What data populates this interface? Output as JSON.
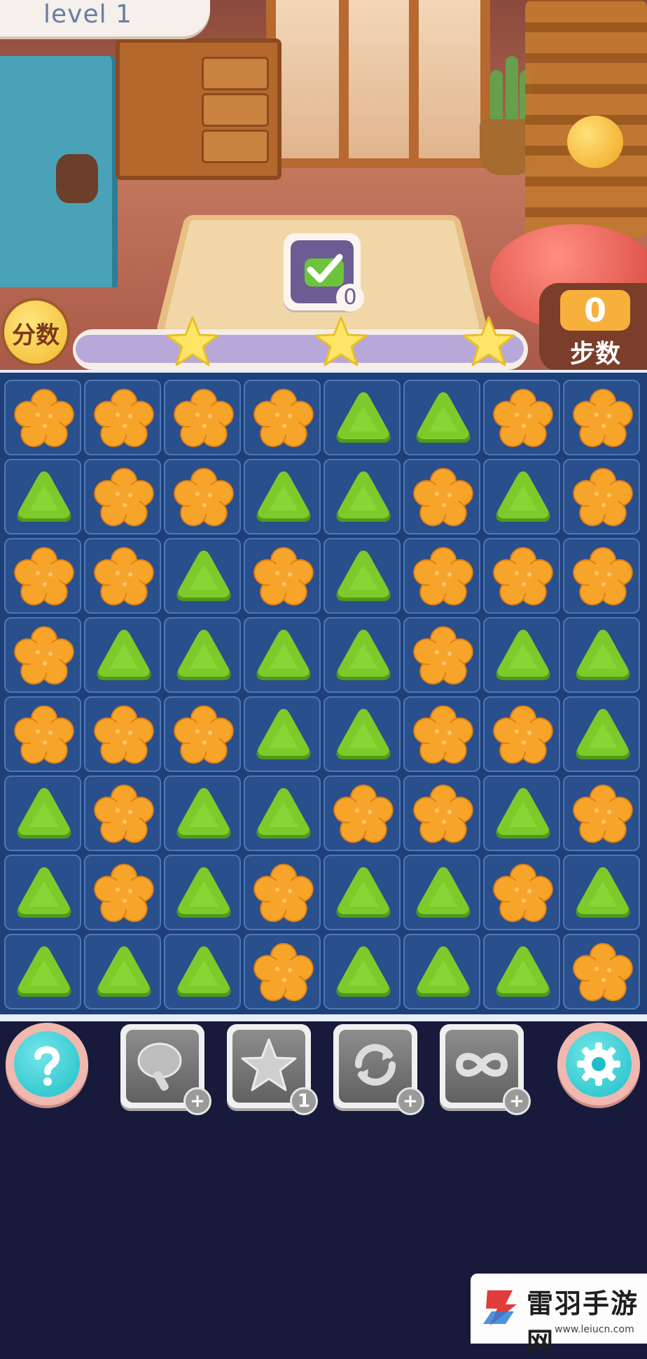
{
  "hud": {
    "level_label": "level 1",
    "goal_count": "0",
    "score_label": "分数",
    "moves_value": "0",
    "moves_label": "步数",
    "progress": 0.0,
    "stars_total": 3
  },
  "board": {
    "rows": 8,
    "cols": 8,
    "tiles": [
      [
        "flower",
        "flower",
        "flower",
        "flower",
        "triangle",
        "triangle",
        "flower",
        "flower"
      ],
      [
        "triangle",
        "flower",
        "flower",
        "triangle",
        "triangle",
        "flower",
        "triangle",
        "flower"
      ],
      [
        "flower",
        "flower",
        "triangle",
        "flower",
        "triangle",
        "flower",
        "flower",
        "flower"
      ],
      [
        "flower",
        "triangle",
        "triangle",
        "triangle",
        "triangle",
        "flower",
        "triangle",
        "triangle"
      ],
      [
        "flower",
        "flower",
        "flower",
        "triangle",
        "triangle",
        "flower",
        "flower",
        "triangle"
      ],
      [
        "triangle",
        "flower",
        "triangle",
        "triangle",
        "flower",
        "flower",
        "triangle",
        "flower"
      ],
      [
        "triangle",
        "flower",
        "triangle",
        "flower",
        "triangle",
        "triangle",
        "flower",
        "triangle"
      ],
      [
        "triangle",
        "triangle",
        "triangle",
        "flower",
        "triangle",
        "triangle",
        "triangle",
        "flower"
      ]
    ],
    "colors": {
      "flower": "#f7a52a",
      "triangle": "#7ccb2a",
      "cell": "#294f8c",
      "board": "#1f3f78"
    }
  },
  "toolbar": {
    "help_icon": "question-icon",
    "settings_icon": "gear-icon",
    "boosters": [
      {
        "icon": "hammer-icon",
        "count": "+"
      },
      {
        "icon": "star-icon",
        "count": "1"
      },
      {
        "icon": "shuffle-icon",
        "count": "+"
      },
      {
        "icon": "infinity-icon",
        "count": "+"
      }
    ]
  },
  "watermark": {
    "title": "雷羽手游网",
    "url": "www.leiucn.com"
  }
}
